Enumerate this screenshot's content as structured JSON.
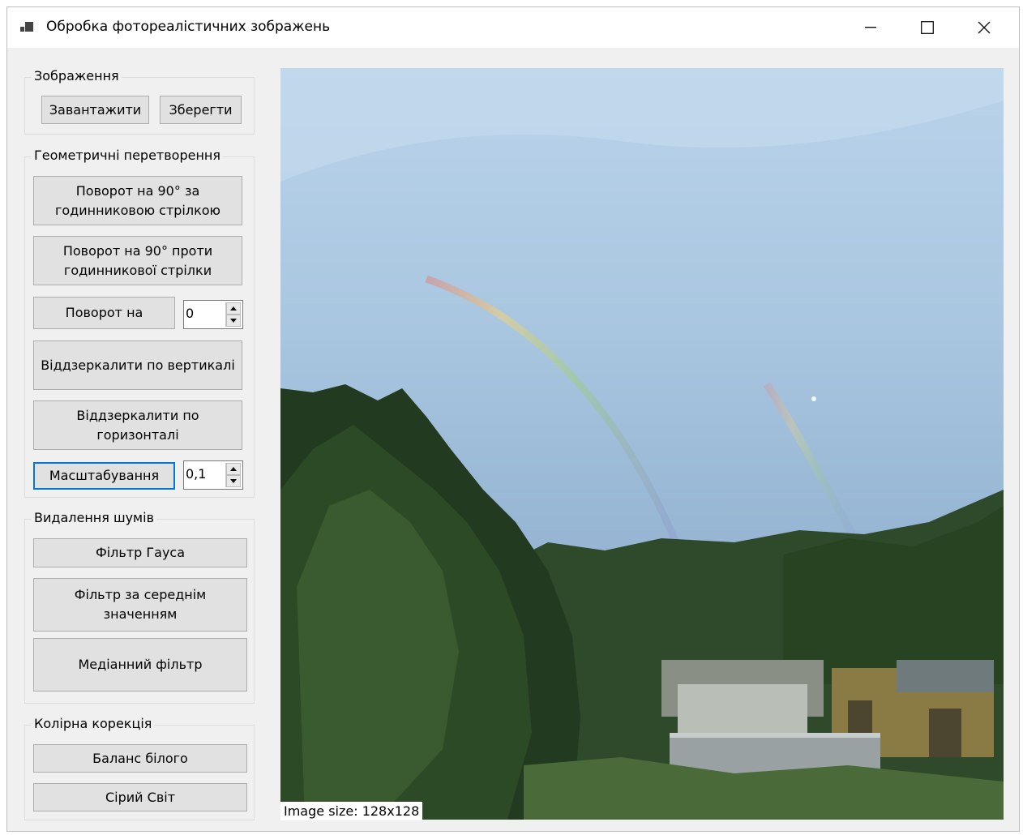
{
  "window": {
    "title": "Обробка фотореалістичних зображень",
    "controls": {
      "minimize": "minimize-icon",
      "maximize": "maximize-icon",
      "close": "close-icon"
    }
  },
  "groups": {
    "image": {
      "legend": "Зображення",
      "load": "Завантажити",
      "save": "Зберегти"
    },
    "geometry": {
      "legend": "Геометричні перетворення",
      "rotate_cw": "Поворот на 90° за годинниковою стрілкою",
      "rotate_ccw": "Поворот на 90° проти годинникової стрілки",
      "rotate_by": "Поворот на",
      "rotate_value": "0",
      "flip_vertical": "Віддзеркалити по вертикалі",
      "flip_horizontal": "Віддзеркалити по горизонталі",
      "scale": "Масштабування",
      "scale_value": "0,1"
    },
    "noise": {
      "legend": "Видалення шумів",
      "gauss": "Фільтр Гауса",
      "mean": "Фільтр за середнім значенням",
      "median": "Медіанний фільтр"
    },
    "color": {
      "legend": "Колірна корекція",
      "white_balance": "Баланс білого",
      "gray_world": "Сірий Світ"
    }
  },
  "picture": {
    "alt_icon": "rainbow-landscape-image"
  },
  "status": {
    "image_size": "Image size: 128x128"
  }
}
